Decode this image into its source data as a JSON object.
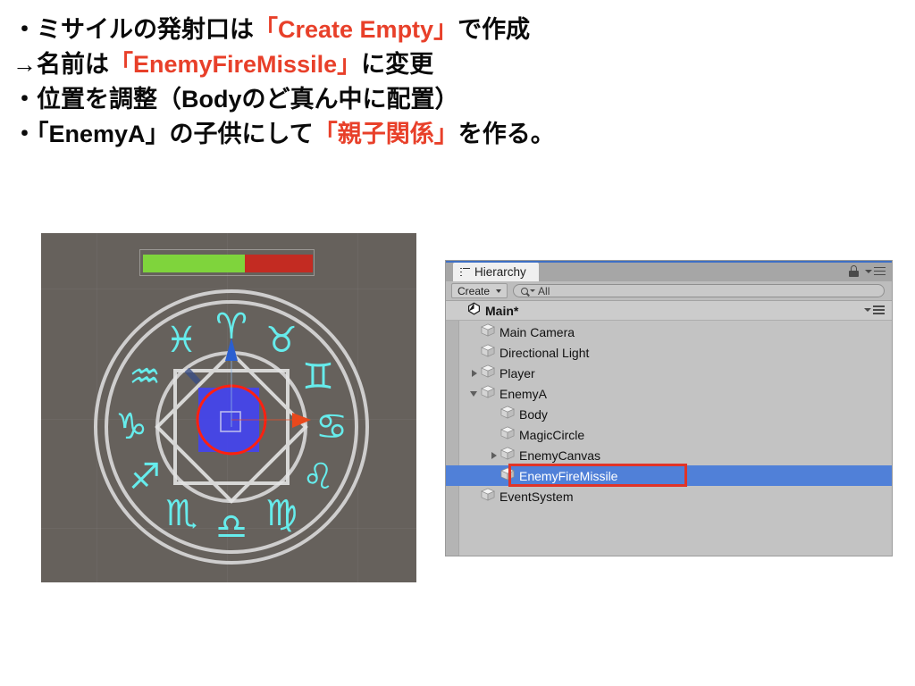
{
  "notes": {
    "lines": [
      {
        "segments": [
          {
            "t": "・ミサイルの発射口は",
            "hl": false
          },
          {
            "t": "「Create Empty」",
            "hl": true
          },
          {
            "t": "で作成",
            "hl": false
          }
        ]
      },
      {
        "segments": [
          {
            "t": "→名前は",
            "hl": false
          },
          {
            "t": "「EnemyFireMissile」",
            "hl": true
          },
          {
            "t": "に変更",
            "hl": false
          }
        ]
      },
      {
        "segments": [
          {
            "t": "・位置を調整（Bodyのど真ん中に配置）",
            "hl": false
          }
        ]
      },
      {
        "segments": [
          {
            "t": "・「EnemyA」の子供にして",
            "hl": false
          },
          {
            "t": "「親子関係」",
            "hl": true
          },
          {
            "t": "を作る。",
            "hl": false
          }
        ]
      }
    ],
    "highlight_color": "#e8402a",
    "text_color": "#0a0a0a"
  },
  "scene_view": {
    "background_color": "#66615c",
    "health_bar": {
      "green_percent": 60,
      "red_percent": 40,
      "green_color": "#7fd43c",
      "red_color": "#c32b22"
    },
    "magic_circle": {
      "ring_color": "#d8d8d8",
      "symbol_color": "#66ecec",
      "zodiac_symbols": [
        "♈",
        "♉",
        "♊",
        "♋",
        "♌",
        "♍",
        "♎",
        "♏",
        "♐",
        "♑",
        "♒",
        "♓"
      ],
      "body_fill_color": "#4444ee",
      "collider_circle_color": "#ff2010",
      "gizmo_up_arrow_color": "#2b5fd0",
      "gizmo_right_arrow_color": "#e8481c"
    }
  },
  "hierarchy_panel": {
    "tab_label": "Hierarchy",
    "tab_icon": "list-icon",
    "lock_icon": "lock-icon",
    "menu_icon": "hamburger-menu-icon",
    "toolbar": {
      "create_label": "Create",
      "create_caret": "chevron-down-icon",
      "search_icon": "search-icon",
      "search_value": "All",
      "search_placeholder": "All"
    },
    "scene_row": {
      "expand_state": "expanded",
      "icon": "unity-logo-icon",
      "name": "Main*",
      "menu_icon": "hamburger-menu-icon"
    },
    "selection_color": "#5080d8",
    "annotation_box_color": "#e03428",
    "panel_bg_color": "#c3c3c3",
    "items": [
      {
        "name": "Main Camera",
        "indent": 1,
        "expand": "none",
        "selected": false,
        "icon": "gameobject-cube-icon"
      },
      {
        "name": "Directional Light",
        "indent": 1,
        "expand": "none",
        "selected": false,
        "icon": "gameobject-cube-icon"
      },
      {
        "name": "Player",
        "indent": 1,
        "expand": "collapsed",
        "selected": false,
        "icon": "gameobject-cube-icon"
      },
      {
        "name": "EnemyA",
        "indent": 1,
        "expand": "expanded",
        "selected": false,
        "icon": "gameobject-cube-icon"
      },
      {
        "name": "Body",
        "indent": 2,
        "expand": "none",
        "selected": false,
        "icon": "gameobject-cube-icon"
      },
      {
        "name": "MagicCircle",
        "indent": 2,
        "expand": "none",
        "selected": false,
        "icon": "gameobject-cube-icon"
      },
      {
        "name": "EnemyCanvas",
        "indent": 2,
        "expand": "collapsed",
        "selected": false,
        "icon": "gameobject-cube-icon"
      },
      {
        "name": "EnemyFireMissile",
        "indent": 2,
        "expand": "none",
        "selected": true,
        "icon": "gameobject-cube-icon"
      },
      {
        "name": "EventSystem",
        "indent": 1,
        "expand": "none",
        "selected": false,
        "icon": "gameobject-cube-icon"
      }
    ]
  }
}
